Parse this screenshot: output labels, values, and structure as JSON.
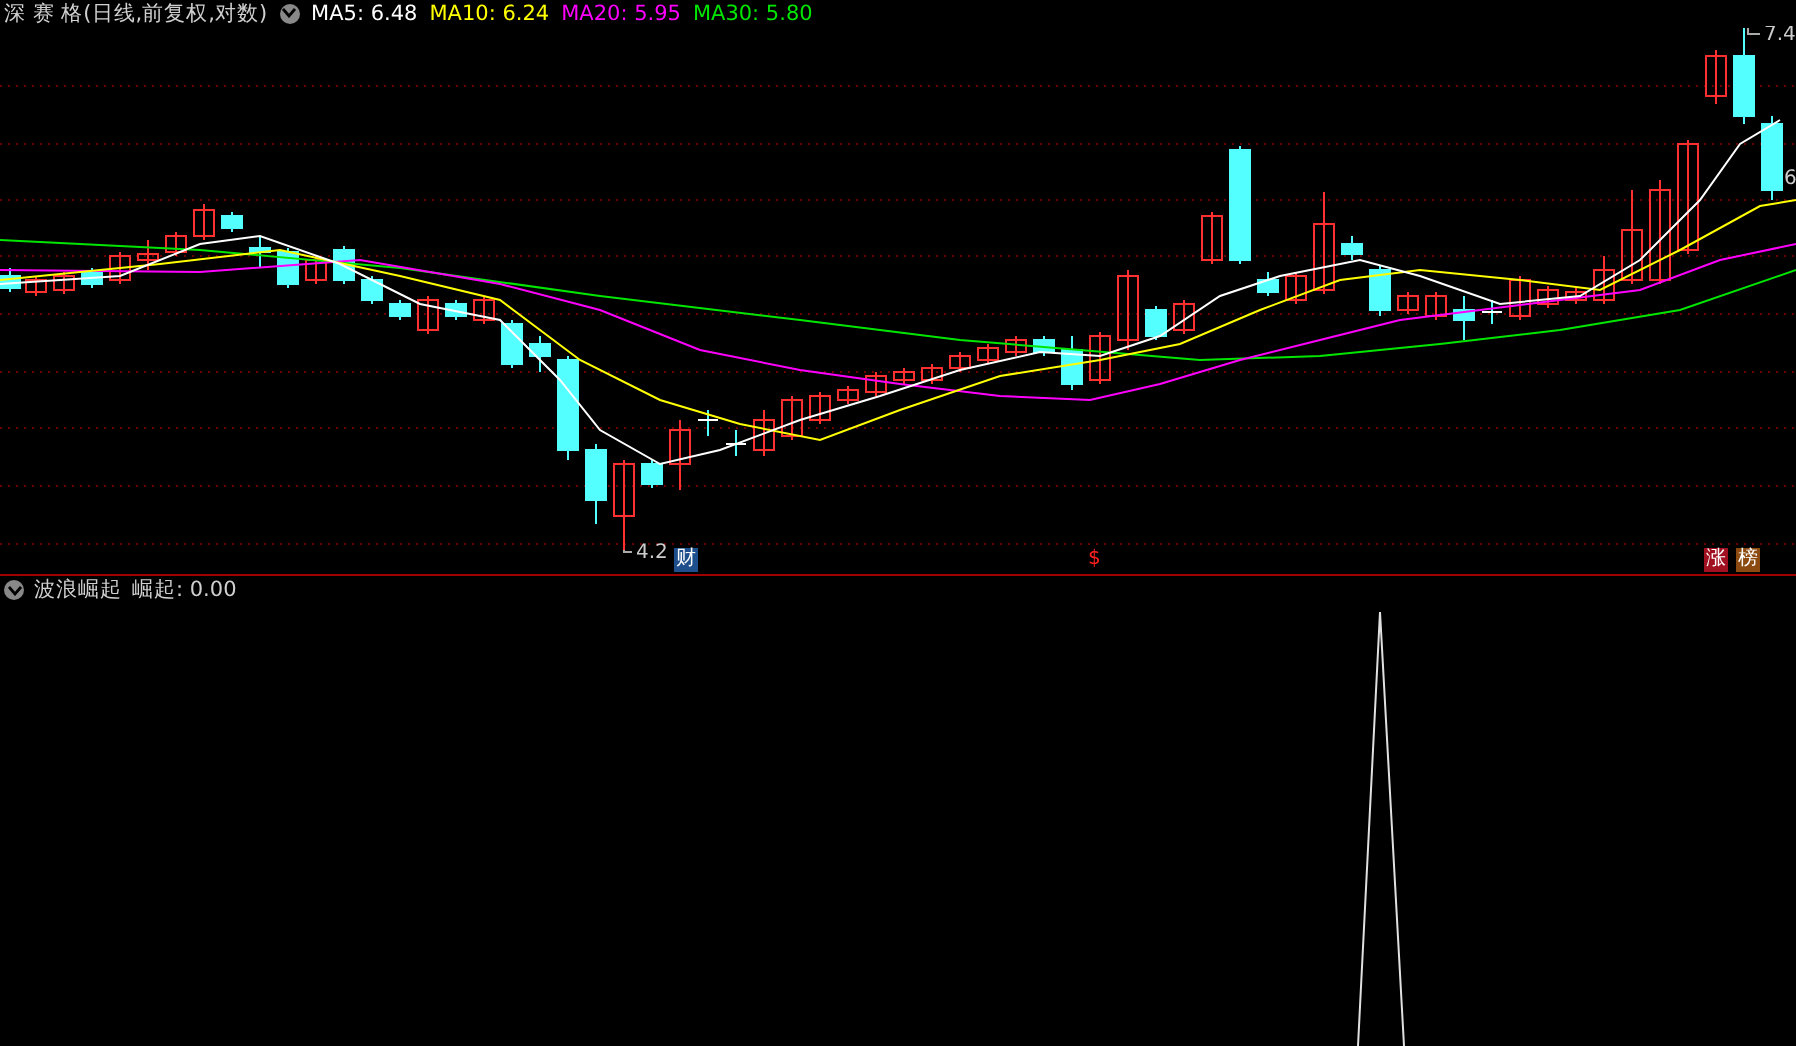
{
  "header": {
    "title": "深 赛 格(日线,前复权,对数)",
    "ma_values": [
      {
        "label": "MA5: 6.48",
        "color": "#ffffff"
      },
      {
        "label": "MA10: 6.24",
        "color": "#ffff00"
      },
      {
        "label": "MA20: 5.95",
        "color": "#ff00ff"
      },
      {
        "label": "MA30: 5.80",
        "color": "#00e600"
      }
    ]
  },
  "price_chart": {
    "price_labels": [
      {
        "text": "4.2",
        "kind": "low"
      },
      {
        "text": "7.4",
        "kind": "high"
      },
      {
        "text": "6",
        "kind": "edge"
      }
    ],
    "markers": [
      {
        "text": "财",
        "color": "#1e4f8c"
      },
      {
        "text": "$",
        "color": "#000000"
      },
      {
        "text": "涨",
        "color": "#a01020"
      },
      {
        "text": "榜",
        "color": "#8a4a10"
      }
    ]
  },
  "indicator": {
    "name": "波浪崛起",
    "reading": "崛起: 0.00"
  }
}
